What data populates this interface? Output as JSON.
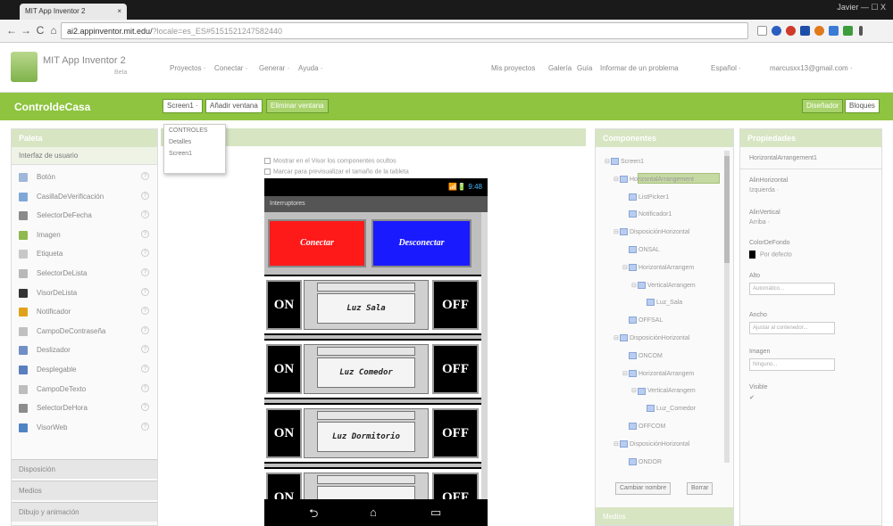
{
  "browser": {
    "tab_title": "MIT App Inventor 2",
    "tab_close": "×",
    "window_controls": "Javier  —  ☐  X",
    "url_host": "ai2.appinventor.mit.edu/",
    "url_rest": "?locale=es_ES#5151521247582440"
  },
  "app": {
    "brand": "MIT App Inventor 2",
    "beta": "Beta",
    "menus": [
      "Proyectos ·",
      "Conectar ·",
      "Generar ·",
      "Ayuda ·"
    ],
    "right_menus": [
      "Mis proyectos",
      "Galería",
      "Guía",
      "Informar de un problema",
      "Español ·",
      "marcusxx13@gmail.com ·"
    ]
  },
  "toolbar": {
    "project_name": "ControldeCasa",
    "screen_select": "Screen1 ·",
    "add_screen": "Añadir ventana",
    "remove_screen": "Eliminar ventana",
    "designer": "Diseñador",
    "blocks": "Bloques"
  },
  "screen_dropdown": [
    "CONTROLES",
    "Detalles",
    "Screen1"
  ],
  "palette": {
    "title": "Paleta",
    "subhead": "Interfaz de usuario",
    "items": [
      {
        "label": "Botón",
        "icon_color": "#9fb7d9"
      },
      {
        "label": "CasillaDeVerificación",
        "icon_color": "#7fa8d8"
      },
      {
        "label": "SelectorDeFecha",
        "icon_color": "#8a8a8a"
      },
      {
        "label": "Imagen",
        "icon_color": "#8fb84d"
      },
      {
        "label": "Etiqueta",
        "icon_color": "#c8c8c8"
      },
      {
        "label": "SelectorDeLista",
        "icon_color": "#b8b8b8"
      },
      {
        "label": "VisorDeLista",
        "icon_color": "#333333"
      },
      {
        "label": "Notificador",
        "icon_color": "#e0a21a"
      },
      {
        "label": "CampoDeContraseña",
        "icon_color": "#c0c0c0"
      },
      {
        "label": "Deslizador",
        "icon_color": "#6f8fc6"
      },
      {
        "label": "Desplegable",
        "icon_color": "#5a7fbf"
      },
      {
        "label": "CampoDeTexto",
        "icon_color": "#bdbdbd"
      },
      {
        "label": "SelectorDeHora",
        "icon_color": "#8c8c8c"
      },
      {
        "label": "VisorWeb",
        "icon_color": "#4f84c4"
      }
    ],
    "sections": [
      "Disposición",
      "Medios",
      "Dibujo y animación"
    ]
  },
  "viewer": {
    "checkbox1": "Mostrar en el Visor los componentes ocultos",
    "checkbox2": "Marcar para previsualizar el tamaño de la tableta",
    "status_time": "📶🔋 9:48",
    "app_title": "Interruptores",
    "connect": "Conectar",
    "disconnect": "Desconectar",
    "on_label": "ON",
    "off_label": "OFF",
    "rooms": [
      "Luz Sala",
      "Luz Comedor",
      "Luz Dormitorio",
      ""
    ],
    "nav_back": "⮌",
    "nav_home": "⌂",
    "nav_recent": "▭"
  },
  "components": {
    "title": "Componentes",
    "tree": [
      "Screen1",
      "HorizontalArrangement",
      "ListPicker1",
      "Notificador1",
      "DisposiciónHorizontal",
      "ONSAL",
      "HorizontalArrangem",
      "VerticalArrangem",
      "Luz_Sala",
      "OFFSAL",
      "DisposiciónHorizontal",
      "ONCOM",
      "HorizontalArrangem",
      "VerticalArrangem",
      "Luz_Comedor",
      "OFFCOM",
      "DisposiciónHorizontal",
      "ONDOR"
    ],
    "rename": "Cambiar nombre",
    "delete": "Borrar",
    "media": "Medios"
  },
  "properties": {
    "title": "Propiedades",
    "component": "HorizontalArrangement1",
    "align_h_label": "AlinHorizontal",
    "align_h_value": "Izquierda ·",
    "align_v_label": "AlinVertical",
    "align_v_value": "Arriba ·",
    "bg_label": "ColorDeFondo",
    "bg_value": "Por defecto",
    "height_label": "Alto",
    "height_value": "Automático...",
    "width_label": "Ancho",
    "width_value": "Ajustar al contenedor...",
    "image_label": "Imagen",
    "image_value": "Ninguno...",
    "visible_label": "Visible",
    "visible_value": "✔"
  }
}
